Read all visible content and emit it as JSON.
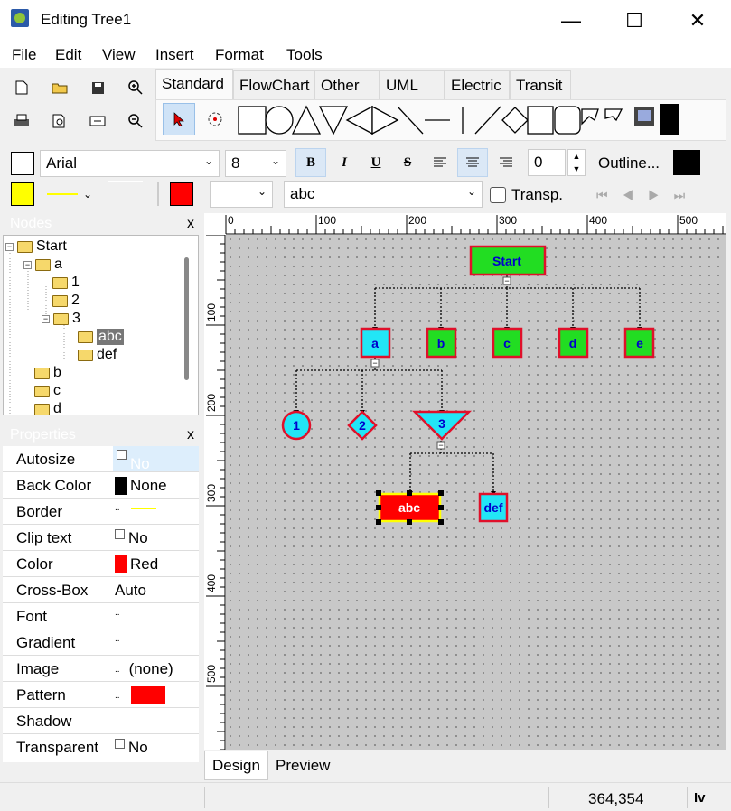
{
  "window": {
    "title": "Editing Tree1",
    "min": "—",
    "max": "☐",
    "close": "✕"
  },
  "menu": [
    "File",
    "Edit",
    "View",
    "Insert",
    "Format",
    "Tools"
  ],
  "gallery_tabs": [
    "Standard",
    "FlowChart",
    "Other",
    "UML",
    "Electric",
    "Transit"
  ],
  "format": {
    "font": "Arial",
    "size": "8",
    "bold": "B",
    "italic": "I",
    "underline": "U",
    "strike": "S",
    "outline_number": "0",
    "outline_label": "Outline...",
    "text_value": "abc",
    "transp_label": "Transp."
  },
  "nodes_panel": {
    "title": "Nodes",
    "close": "x",
    "tree": [
      "Start",
      "a",
      "1",
      "2",
      "3",
      "abc",
      "def",
      "b",
      "c",
      "d"
    ]
  },
  "props_panel": {
    "title": "Properties",
    "close": "x",
    "rows": [
      {
        "name": "Autosize",
        "value": "No"
      },
      {
        "name": "Back Color",
        "value": "None"
      },
      {
        "name": "Border",
        "value": ""
      },
      {
        "name": "Clip text",
        "value": "No"
      },
      {
        "name": "Color",
        "value": "Red"
      },
      {
        "name": "Cross-Box",
        "value": "Auto"
      },
      {
        "name": "Font",
        "value": ""
      },
      {
        "name": "Gradient",
        "value": ""
      },
      {
        "name": "Image",
        "value": "(none)"
      },
      {
        "name": "Pattern",
        "value": ""
      },
      {
        "name": "Shadow",
        "value": ""
      },
      {
        "name": "Transparent",
        "value": "No"
      }
    ]
  },
  "ruler": {
    "h": [
      "0",
      "100",
      "200",
      "300",
      "400",
      "500"
    ],
    "v": [
      "100",
      "200",
      "300",
      "400",
      "500"
    ]
  },
  "diagram": {
    "start": "Start",
    "a": "a",
    "b": "b",
    "c": "c",
    "d": "d",
    "e": "e",
    "n1": "1",
    "n2": "2",
    "n3": "3",
    "abc": "abc",
    "def": "def",
    "collapse": "−"
  },
  "bottom_tabs": [
    "Design",
    "Preview"
  ],
  "status": {
    "coords": "364,354",
    "mode": "Iv"
  },
  "colors": {
    "green": "#22dd22",
    "cyan": "#22e6f6",
    "red": "#ff0000",
    "border_red": "#e0102a",
    "yellow": "#ffff00"
  }
}
